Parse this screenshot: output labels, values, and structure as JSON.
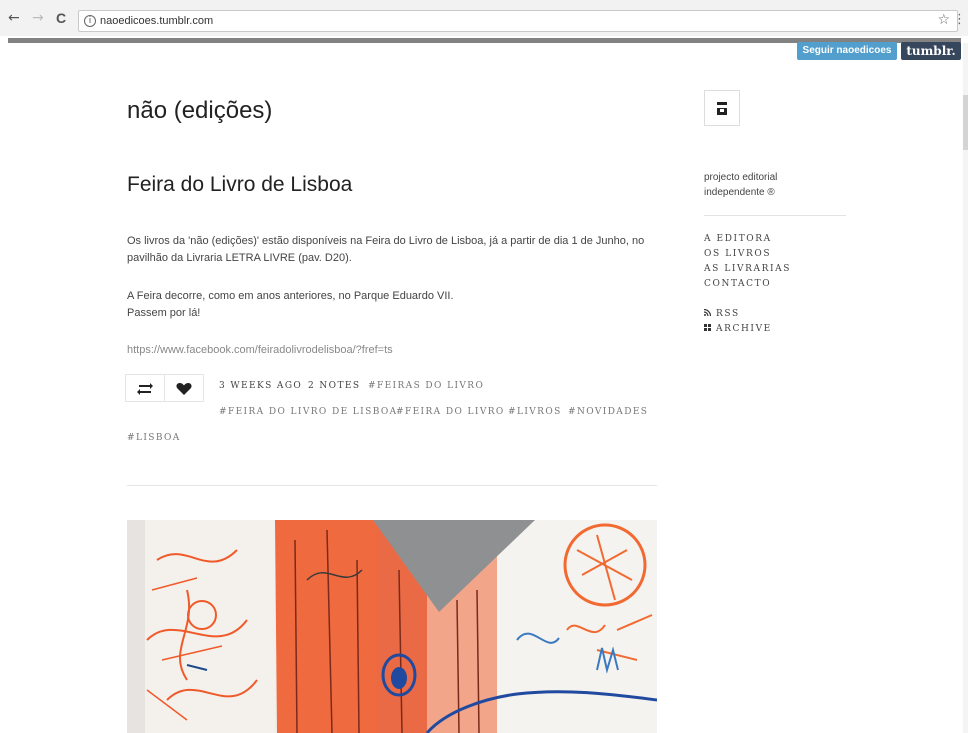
{
  "browser": {
    "back_icon": "←",
    "forward_icon": "→",
    "reload_icon": "C",
    "info_icon": "i",
    "url": "naoedicoes.tumblr.com",
    "star_icon": "☆",
    "menu_icon": "⋮"
  },
  "tumblr_controls": {
    "follow_label": "Seguir naoedicoes",
    "logo_label": "tumblr.",
    "follow_color": "#529ecc",
    "logo_color": "#36465d"
  },
  "blog": {
    "title": "não (edições)"
  },
  "post": {
    "title": "Feira do Livro de Lisboa",
    "p1_line1": "Os livros da 'não (edições)' estão disponíveis na Feira do Livro de Lisboa, já a partir de dia 1 de Junho, no",
    "p1_line2": "pavilhão da Livraria LETRA LIVRE (pav. D20).",
    "p2_line1": "A Feira decorre, como em anos anteriores, no Parque Eduardo VII.",
    "p2_line2": "Passem por lá!",
    "link": "https://www.facebook.com/feiradolivrodelisboa/?fref=ts",
    "reblog_icon": "reblog-icon",
    "like_icon": "heart-icon",
    "date": "3 WEEKS AGO",
    "notes": "2 NOTES",
    "tags": [
      "#FEIRAS DO LIVRO",
      "#FEIRA DO LIVRO DE LISBOA",
      "#FEIRA DO LIVRO",
      "#LIVROS",
      "#NOVIDADES",
      "#LISBOA"
    ]
  },
  "sidebar": {
    "description_line1": "projecto editorial",
    "description_line2": "independente ®",
    "nav": [
      "A EDITORA",
      "OS LIVROS",
      "AS LIVRARIAS",
      "CONTACTO"
    ],
    "rss_icon": "rss-icon",
    "rss_label": "RSS",
    "archive_icon": "grid-icon",
    "archive_label": "ARCHIVE"
  }
}
